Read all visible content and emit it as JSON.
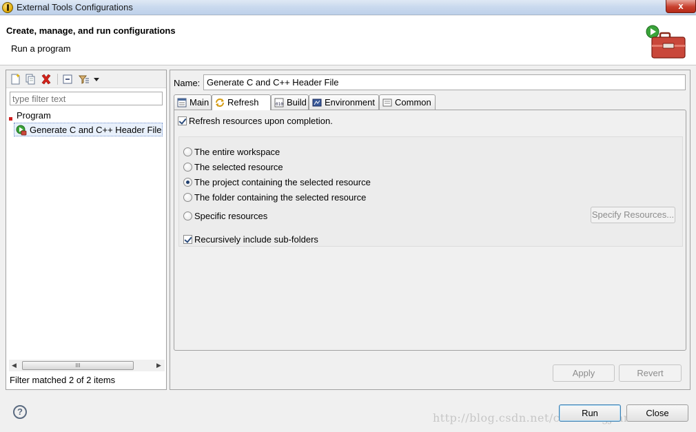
{
  "window": {
    "title": "External Tools Configurations",
    "close_glyph": "x"
  },
  "header": {
    "heading": "Create, manage, and run configurations",
    "subheading": "Run a program",
    "banner_icon": "toolbox-run-icon"
  },
  "left_panel": {
    "toolbar_icons": [
      "new-launch-config-icon",
      "duplicate-icon",
      "delete-icon",
      "collapse-all-icon",
      "filter-icon",
      "chevron-down-icon"
    ],
    "filter": {
      "placeholder": "type filter text",
      "value": ""
    },
    "tree": {
      "category": "Program",
      "items": [
        {
          "label": "Generate C and C++ Header File",
          "selected": true
        }
      ]
    },
    "scrollbar_thumb": "III",
    "status": "Filter matched 2 of 2 items"
  },
  "right_panel": {
    "name_label": "Name:",
    "name_value": "Generate C and C++ Header File",
    "tabs": [
      {
        "label": "Main",
        "icon": "main-tab-icon",
        "active": false
      },
      {
        "label": "Refresh",
        "icon": "refresh-icon",
        "active": true
      },
      {
        "label": "Build",
        "icon": "build-icon",
        "active": false
      },
      {
        "label": "Environment",
        "icon": "environment-icon",
        "active": false
      },
      {
        "label": "Common",
        "icon": "common-icon",
        "active": false
      }
    ],
    "refresh": {
      "refresh_checkbox": {
        "label": "Refresh resources upon completion.",
        "checked": true
      },
      "scope_options": [
        {
          "label": "The entire workspace",
          "selected": false
        },
        {
          "label": "The selected resource",
          "selected": false
        },
        {
          "label": "The project containing the selected resource",
          "selected": true
        },
        {
          "label": "The folder containing the selected resource",
          "selected": false
        },
        {
          "label": "Specific resources",
          "selected": false
        }
      ],
      "specify_button": "Specify Resources...",
      "recursive_checkbox": {
        "label": "Recursively include sub-folders",
        "checked": true
      }
    },
    "apply_button": "Apply",
    "revert_button": "Revert"
  },
  "footer": {
    "help_glyph": "?",
    "run_button": "Run",
    "close_button": "Close",
    "watermark": "http://blog.csdn.net/chenrongjian"
  }
}
